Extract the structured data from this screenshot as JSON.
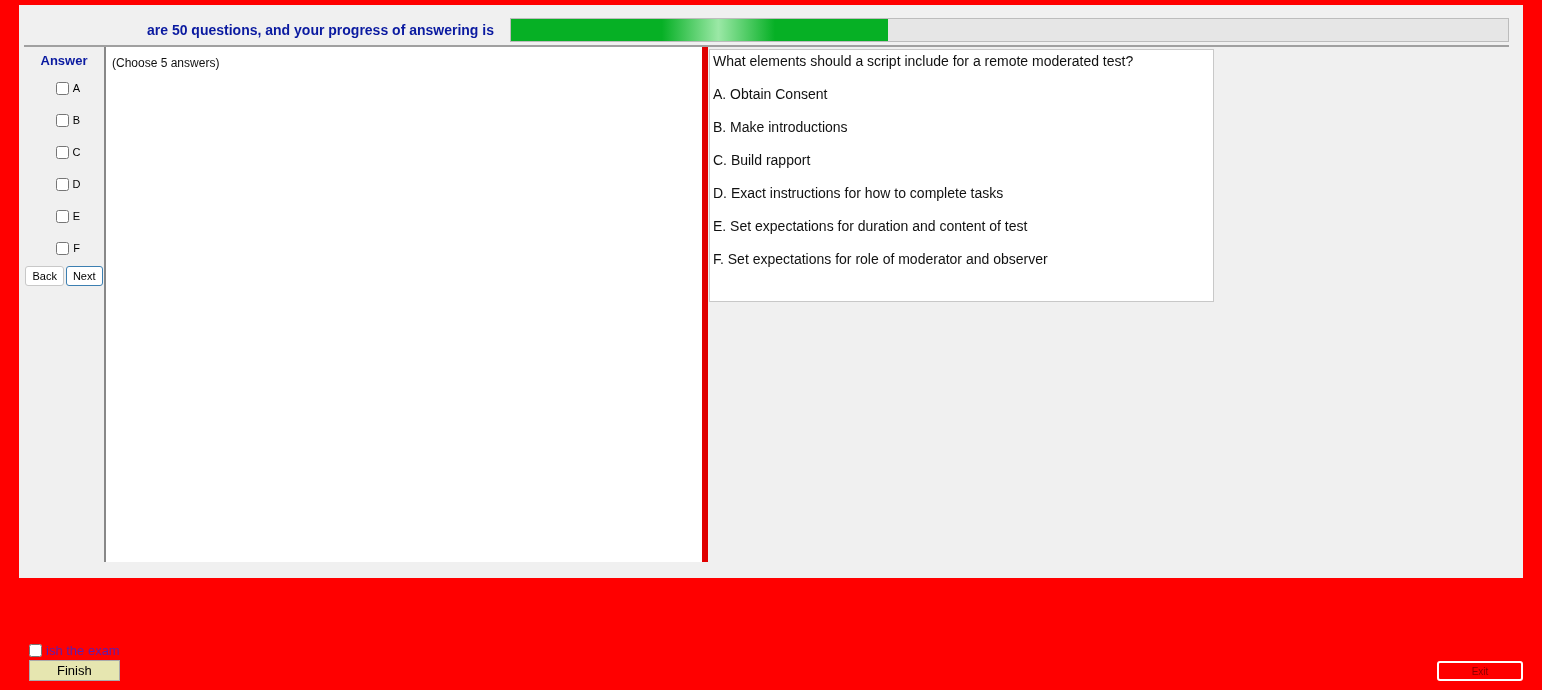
{
  "header": {
    "text": "are 50 questions, and your progress of answering is",
    "progress": {
      "level": 0.378
    }
  },
  "answer_panel": {
    "title": "Answer",
    "options": [
      {
        "label": "A",
        "checked": false
      },
      {
        "label": "B",
        "checked": false
      },
      {
        "label": "C",
        "checked": false
      },
      {
        "label": "D",
        "checked": false
      },
      {
        "label": "E",
        "checked": false
      },
      {
        "label": "F",
        "checked": false
      }
    ],
    "buttons": [
      {
        "label": "Back",
        "focused": false
      },
      {
        "label": "Next",
        "focused": true
      }
    ]
  },
  "answer_area": {
    "text": "(Choose 5 answers)"
  },
  "question": {
    "text": "What elements should a script include for a remote moderated test?",
    "choices": [
      "A.  Obtain Consent",
      "B.  Make introductions",
      "C.  Build rapport",
      "D.  Exact instructions for how to complete tasks",
      "E.  Set expectations for duration and content of test",
      "F.  Set expectations for role of moderator and observer"
    ]
  },
  "footer": {
    "finish_check": {
      "label": "ish the exam",
      "checked": false
    },
    "finish_button": "Finish",
    "exit_button": "Exit"
  }
}
